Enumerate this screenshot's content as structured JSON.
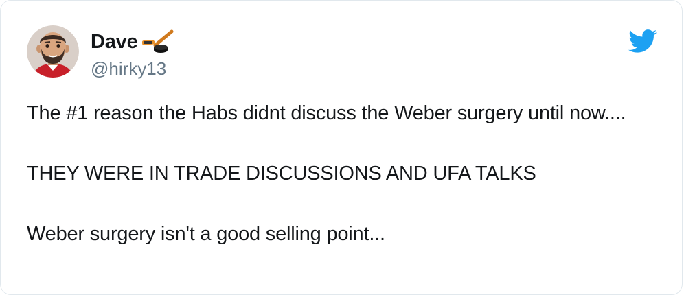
{
  "user": {
    "display_name": "Dave",
    "handle": "@hirky13",
    "name_emoji": "hockey-stick-puck-emoji"
  },
  "tweet": {
    "paragraphs": [
      "The #1 reason the Habs didnt discuss the Weber surgery until now....",
      "THEY WERE IN TRADE DISCUSSIONS AND UFA TALKS",
      "Weber surgery isn't a good selling point..."
    ]
  },
  "icons": {
    "logo": "twitter-bird-icon",
    "avatar": "avatar-memoji"
  },
  "colors": {
    "twitter_blue": "#1da1f2",
    "handle_gray": "#657786",
    "text": "#14171a"
  }
}
